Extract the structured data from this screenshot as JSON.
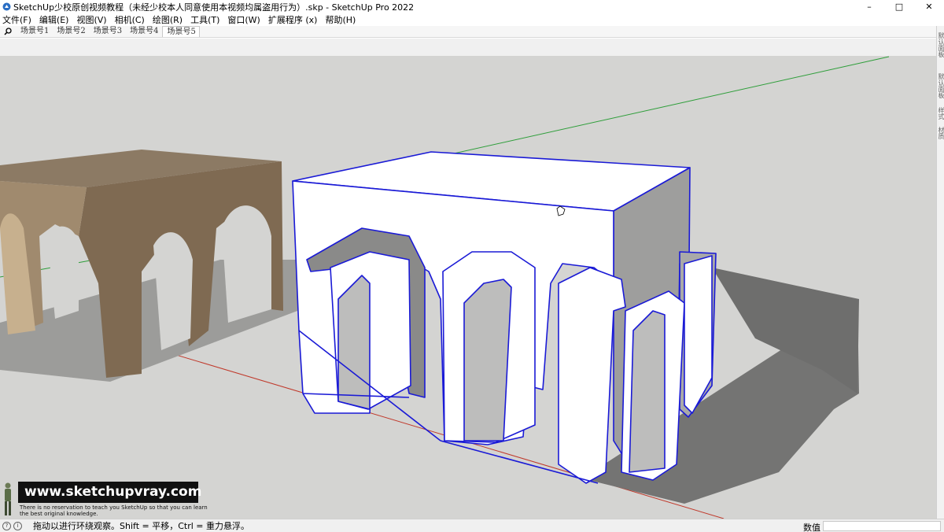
{
  "window": {
    "title": "SketchUp少校原创视频教程（未经少校本人同意使用本视频均属盗用行为）.skp - SketchUp Pro 2022",
    "controls": [
      "–",
      "□",
      "✕"
    ]
  },
  "menu": [
    "文件(F)",
    "编辑(E)",
    "视图(V)",
    "相机(C)",
    "绘图(R)",
    "工具(T)",
    "窗口(W)",
    "扩展程序 (x)",
    "帮助(H)"
  ],
  "scenes": {
    "search_icon": "search-icon",
    "tabs": [
      "场景号1",
      "场景号2",
      "场景号3",
      "场景号4",
      "场景号5"
    ],
    "active_index": 4
  },
  "right_panel_tabs": [
    "默认面板",
    "默认面板",
    "样式",
    "材质"
  ],
  "watermark": {
    "url": "www.sketchupvray.com",
    "line1": "There is no reservation to teach you SketchUp so that you can learn",
    "line2": "the best original knowledge."
  },
  "status": {
    "hint": "拖动以进行环绕观察。Shift = 平移，Ctrl = 重力悬浮。",
    "measurements_label": "数值",
    "measurements_value": ""
  },
  "colors": {
    "viewport_bg": "#d4d4d2",
    "selection": "#1a1ad6",
    "wood": "#8a7660",
    "axis_red": "#c0392b",
    "axis_green": "#2e9e3a"
  }
}
